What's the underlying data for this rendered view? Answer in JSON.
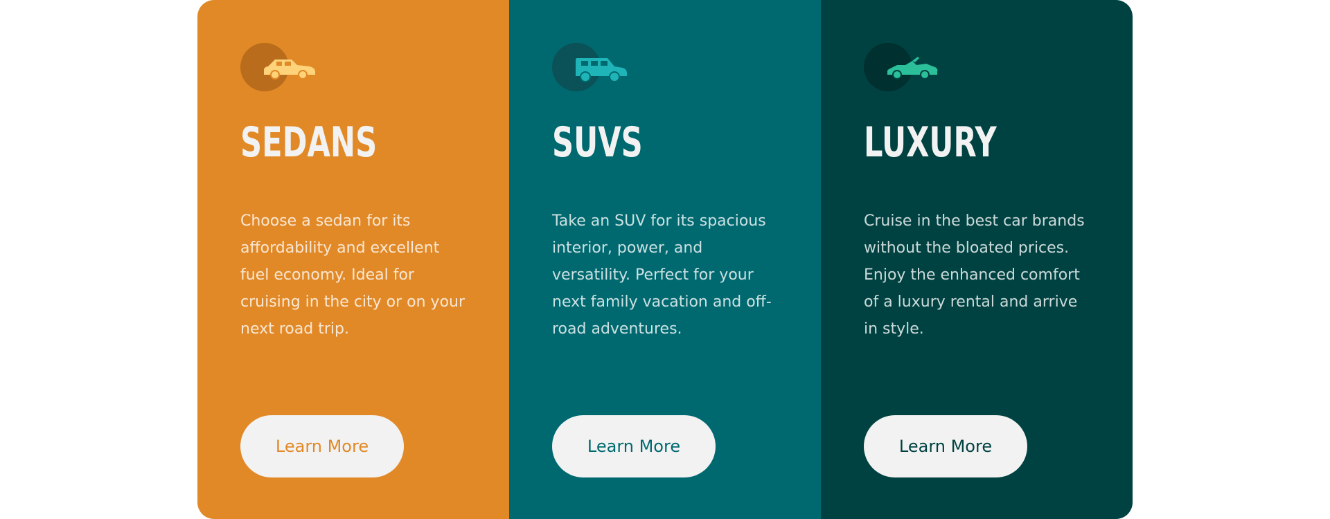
{
  "cards": [
    {
      "icon": "sedan-car-icon",
      "title": "SEDANS",
      "description": "Choose a sedan for its affordability and excellent fuel economy. Ideal for cruising in the city or on your next road trip.",
      "button_label": "Learn More",
      "colors": {
        "background": "#e28927",
        "icon": "#ffd37a",
        "button_text": "#e28927"
      }
    },
    {
      "icon": "suv-car-icon",
      "title": "SUVS",
      "description": "Take an SUV for its spacious interior, power, and versatility. Perfect for your next family vacation and off-road adventures.",
      "button_label": "Learn More",
      "colors": {
        "background": "#006970",
        "icon": "#1fb5b8",
        "button_text": "#006970"
      }
    },
    {
      "icon": "luxury-car-icon",
      "title": "LUXURY",
      "description": "Cruise in the best car brands without the bloated prices. Enjoy the enhanced comfort of a luxury rental and arrive in style.",
      "button_label": "Learn More",
      "colors": {
        "background": "#004241",
        "icon": "#2bbf9a",
        "button_text": "#004241"
      }
    }
  ],
  "colors": {
    "page_background": "#ffffff",
    "button_background": "#f2f2f2",
    "text": "#f2f2f2"
  }
}
